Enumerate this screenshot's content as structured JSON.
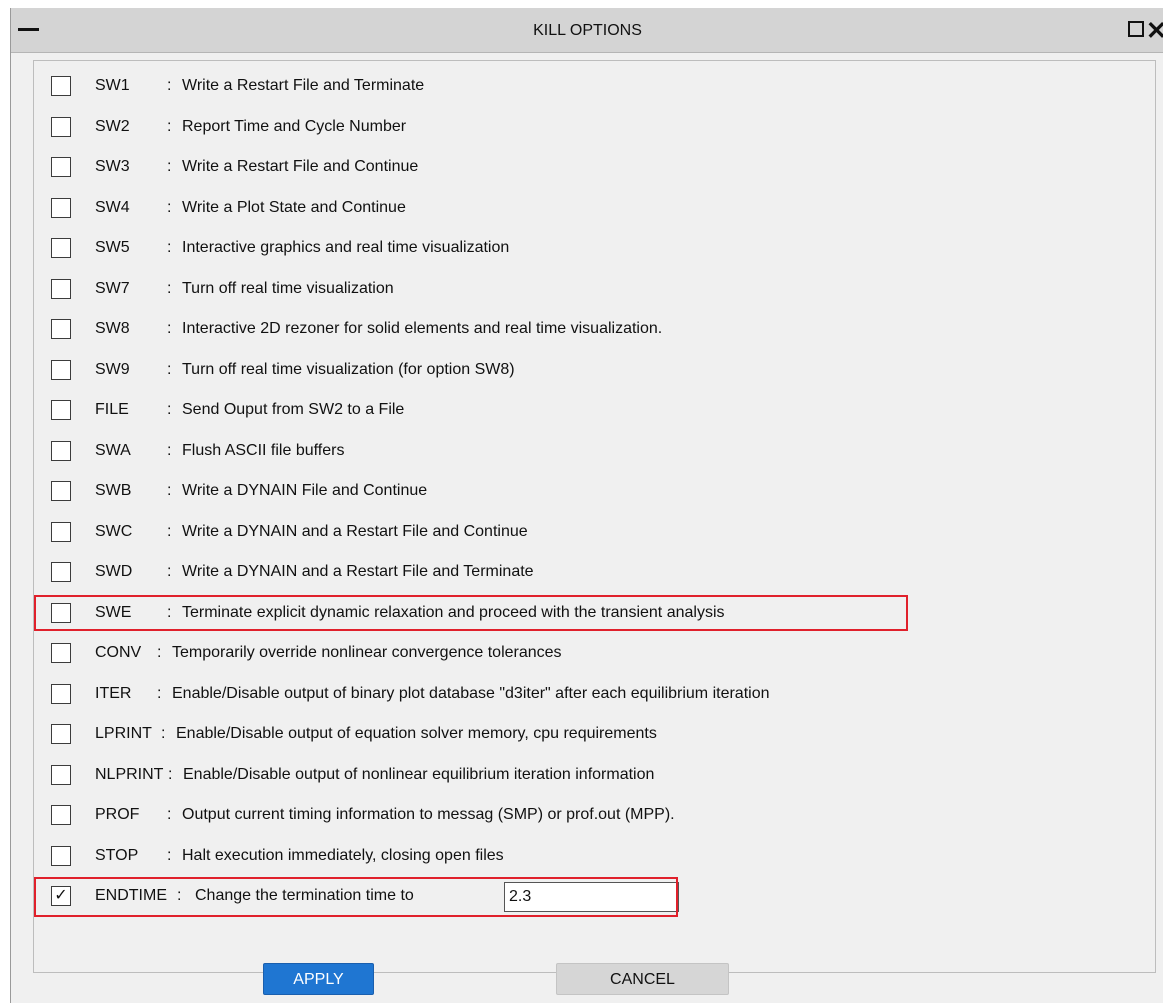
{
  "window": {
    "title": "KILL OPTIONS"
  },
  "options": [
    {
      "code": "SW1",
      "description": "Write a Restart File and Terminate",
      "checked": false
    },
    {
      "code": "SW2",
      "description": "Report Time and Cycle Number",
      "checked": false
    },
    {
      "code": "SW3",
      "description": "Write a Restart File and Continue",
      "checked": false
    },
    {
      "code": "SW4",
      "description": "Write a Plot State and Continue",
      "checked": false
    },
    {
      "code": "SW5",
      "description": "Interactive graphics and real time visualization",
      "checked": false
    },
    {
      "code": "SW7",
      "description": "Turn off real time visualization",
      "checked": false
    },
    {
      "code": "SW8",
      "description": "Interactive 2D rezoner for solid elements and real time visualization.",
      "checked": false
    },
    {
      "code": "SW9",
      "description": "Turn off real time visualization (for option SW8)",
      "checked": false
    },
    {
      "code": "FILE",
      "description": "Send Ouput from SW2 to a File",
      "checked": false
    },
    {
      "code": "SWA",
      "description": "Flush ASCII file buffers",
      "checked": false
    },
    {
      "code": "SWB",
      "description": "Write a DYNAIN File and Continue",
      "checked": false
    },
    {
      "code": "SWC",
      "description": "Write a DYNAIN and a Restart File and Continue",
      "checked": false
    },
    {
      "code": "SWD",
      "description": "Write a DYNAIN and a Restart File and Terminate",
      "checked": false
    },
    {
      "code": "SWE",
      "description": "Terminate explicit dynamic relaxation and proceed with the transient analysis",
      "checked": false,
      "highlighted": true
    },
    {
      "code": "CONV",
      "description": "Temporarily override nonlinear convergence tolerances",
      "checked": false
    },
    {
      "code": "ITER",
      "description": "Enable/Disable output of binary plot database \"d3iter\" after each equilibrium iteration",
      "checked": false
    },
    {
      "code": "LPRINT",
      "description": "Enable/Disable output of equation solver memory, cpu requirements",
      "checked": false
    },
    {
      "code": "NLPRINT",
      "description": "Enable/Disable output of nonlinear equilibrium iteration information",
      "checked": false
    },
    {
      "code": "PROF",
      "description": "Output current timing information to messag (SMP) or prof.out (MPP).",
      "checked": false
    },
    {
      "code": "STOP",
      "description": "Halt execution immediately, closing open files",
      "checked": false
    }
  ],
  "endtime": {
    "code": "ENDTIME",
    "description": "Change the termination time to",
    "checked": true,
    "check_glyph": "✓",
    "value": "2.3",
    "highlighted": true
  },
  "colon": ":",
  "buttons": {
    "apply": "APPLY",
    "cancel": "CANCEL"
  },
  "colors": {
    "highlight": "#e0202b",
    "apply_bg": "#1f76d2",
    "cancel_bg": "#d6d6d6"
  },
  "icons": {
    "minimize": "minus-icon",
    "maximize": "square-icon",
    "close": "close-icon",
    "check": "checkmark-icon"
  }
}
